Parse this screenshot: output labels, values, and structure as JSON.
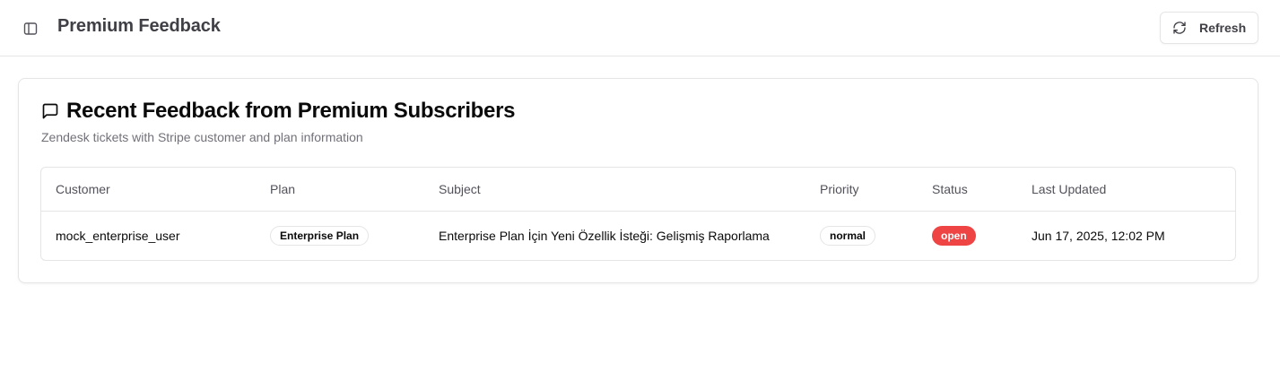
{
  "header": {
    "title": "Premium Feedback",
    "refresh_label": "Refresh"
  },
  "card": {
    "title": "Recent Feedback from Premium Subscribers",
    "subtitle": "Zendesk tickets with Stripe customer and plan information"
  },
  "table": {
    "columns": [
      "Customer",
      "Plan",
      "Subject",
      "Priority",
      "Status",
      "Last Updated"
    ],
    "rows": [
      {
        "customer": "mock_enterprise_user",
        "plan": "Enterprise Plan",
        "subject": "Enterprise Plan İçin Yeni Özellik İsteği: Gelişmiş Raporlama",
        "priority": "normal",
        "status": "open",
        "last_updated": "Jun 17, 2025, 12:02 PM"
      }
    ]
  },
  "colors": {
    "status_open": "#ef4444",
    "border": "#e5e5e5"
  },
  "icons": {
    "sidebar_toggle": "panel-left-icon",
    "refresh": "refresh-icon",
    "card_title": "message-square-icon"
  }
}
